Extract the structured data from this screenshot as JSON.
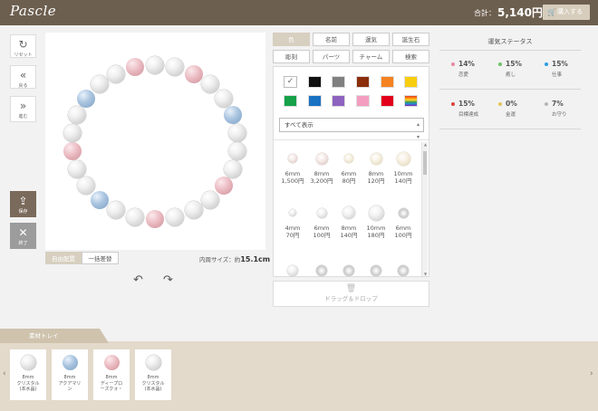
{
  "header": {
    "logo": "Pascle",
    "total_label": "合計：",
    "total_value": "5,140円",
    "buy_label": "購入する"
  },
  "tools": {
    "reset": "リセット",
    "back": "戻る",
    "forward": "進む",
    "save": "保存",
    "exit": "終了"
  },
  "canvas": {
    "mode_free": "自由配置",
    "mode_bulk": "一括差替",
    "inner_size_label": "内周サイズ：約",
    "inner_size_value": "15.1cm"
  },
  "tabs": [
    "色",
    "名前",
    "運気",
    "誕生石",
    "彫刻",
    "パーツ",
    "チャーム",
    "検索"
  ],
  "colors": [
    "#ffffff",
    "#111111",
    "#808080",
    "#8b2e0c",
    "#f58220",
    "#f7ce0f",
    "#17a149",
    "#1a72c3",
    "#8e63bf",
    "#f39ec1",
    "#e2001a",
    "rainbow"
  ],
  "filter": {
    "value": "すべて表示"
  },
  "items": [
    {
      "size": "6mm",
      "price": "1,500円",
      "kind": "pearl-pink"
    },
    {
      "size": "8mm",
      "price": "3,200円",
      "kind": "pearl-pink"
    },
    {
      "size": "6mm",
      "price": "80円",
      "kind": "pearl-cream"
    },
    {
      "size": "8mm",
      "price": "120円",
      "kind": "pearl-cream"
    },
    {
      "size": "10mm",
      "price": "140円",
      "kind": "pearl-cream"
    },
    {
      "size": "4mm",
      "price": "70円",
      "kind": "crys"
    },
    {
      "size": "6mm",
      "price": "100円",
      "kind": "crys"
    },
    {
      "size": "8mm",
      "price": "140円",
      "kind": "crys"
    },
    {
      "size": "10mm",
      "price": "180円",
      "kind": "crys"
    },
    {
      "size": "6mm",
      "price": "100円",
      "kind": "cut"
    }
  ],
  "dragdrop": "ドラッグ＆ドロップ",
  "status": {
    "title": "運気ステータス",
    "stats": [
      {
        "pct": "14%",
        "name": "恋愛",
        "color": "#e98aa0"
      },
      {
        "pct": "15%",
        "name": "癒し",
        "color": "#6cc266"
      },
      {
        "pct": "15%",
        "name": "仕事",
        "color": "#2c9ee0"
      },
      {
        "pct": "15%",
        "name": "目標達成",
        "color": "#d6453f"
      },
      {
        "pct": "0%",
        "name": "金運",
        "color": "#e2c65a"
      },
      {
        "pct": "7%",
        "name": "お守り",
        "color": "#b5b5b5"
      }
    ]
  },
  "tray": {
    "label": "素材トレイ",
    "cards": [
      {
        "size": "8mm",
        "name1": "クリスタル",
        "name2": "(本水晶)"
      },
      {
        "size": "8mm",
        "name1": "アクアマリ",
        "name2": "ン"
      },
      {
        "size": "8mm",
        "name1": "ディープロ",
        "name2": "ーズクォ・"
      },
      {
        "size": "8mm",
        "name1": "クリスタル",
        "name2": "(本水晶)"
      }
    ]
  }
}
